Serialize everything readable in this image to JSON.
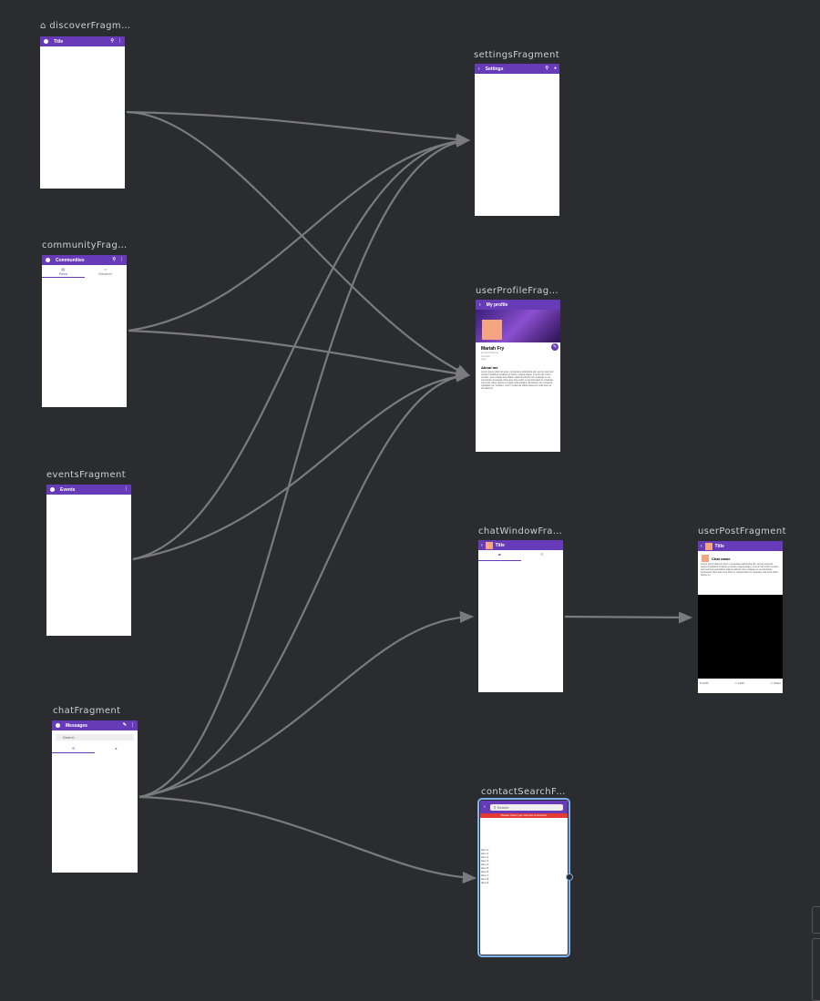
{
  "nodes": {
    "discover": {
      "label": "discoverFragment",
      "bar_title": "Title"
    },
    "community": {
      "label": "communityFragm…",
      "bar_title": "Communities",
      "tabs": [
        "Feed",
        "Member"
      ]
    },
    "events": {
      "label": "eventsFragment",
      "bar_title": "Events"
    },
    "chat": {
      "label": "chatFragment",
      "bar_title": "Messages",
      "search": "Search"
    },
    "settings": {
      "label": "settingsFragment",
      "bar_title": "Settings"
    },
    "profile": {
      "label": "userProfileFragment",
      "bar_title": "My profile",
      "name": "Mariah Fry",
      "sub1": "Email Address",
      "sub2": "Gender",
      "sub3": "Age",
      "about": "About me",
      "body": "Lorem ipsum dolor sit amet, consectetur adipiscing elit, sed do eiusmod tempor incididunt ut labore et dolore magna aliqua. Ut enim ad minim veniam, quis nostrud exercitation ullamco laboris nisi ut aliquip ex ea commodo consequat. Duis aute irure dolor in reprehenderit in voluptate velit esse cillum dolore eu fugiat nulla pariatur. Excepteur sint occaecat cupidatat non proident, sunt in culpa qui officia deserunt mollit anim id est laborum."
    },
    "chatwindow": {
      "label": "chatWindowFrag…",
      "bar_title": "Title"
    },
    "userpost": {
      "label": "userPostFragment",
      "bar_title": "Title",
      "chat_name": "Chat name",
      "body": "Lorem ipsum dolor sit amet, consectetur adipiscing elit, sed do eiusmod tempor incididunt ut labore et dolore magna aliqua. Ut enim ad minim veniam, quis nostrud exercitation ullamco laboris nisi ut aliquip ex ea commodo consequat. Duis aute irure dolor in reprehenderit in voluptate velit esse cillum dolore eu",
      "likes": "120K",
      "comments": "120K",
      "share": "Share"
    },
    "contact": {
      "label": "contactSearchFra…",
      "search": "Search",
      "network": "Please check your internet connection",
      "items": [
        "Item 0",
        "Item 1",
        "Item 2",
        "Item 3",
        "Item 4",
        "Item 5",
        "Item 6",
        "Item 7",
        "Item 8",
        "Item 9"
      ]
    }
  },
  "colors": {
    "canvas": "#2b2c2f",
    "toolbar": "#673ab7",
    "edge": "#7b7b7d",
    "selection": "#7fb2f0"
  },
  "edges": [
    {
      "from": "discoverFragment",
      "to": "settingsFragment"
    },
    {
      "from": "discoverFragment",
      "to": "userProfileFragment"
    },
    {
      "from": "communityFragment",
      "to": "settingsFragment"
    },
    {
      "from": "communityFragment",
      "to": "userProfileFragment"
    },
    {
      "from": "eventsFragment",
      "to": "settingsFragment"
    },
    {
      "from": "eventsFragment",
      "to": "userProfileFragment"
    },
    {
      "from": "chatFragment",
      "to": "settingsFragment"
    },
    {
      "from": "chatFragment",
      "to": "userProfileFragment"
    },
    {
      "from": "chatFragment",
      "to": "chatWindowFragment"
    },
    {
      "from": "chatFragment",
      "to": "contactSearchFragment"
    },
    {
      "from": "chatWindowFragment",
      "to": "userPostFragment"
    }
  ]
}
